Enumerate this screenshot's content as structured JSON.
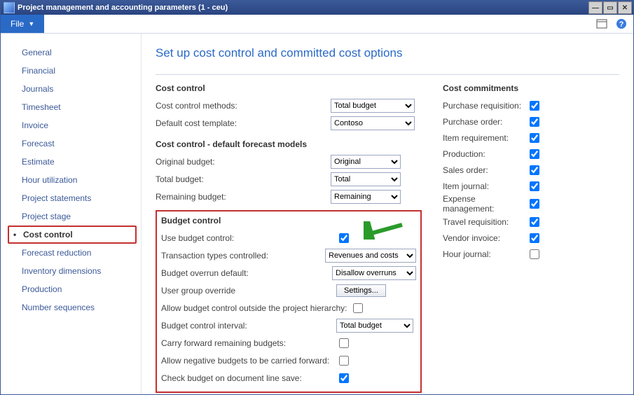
{
  "window": {
    "title": "Project management and accounting parameters (1 - ceu)"
  },
  "menubar": {
    "file": "File"
  },
  "sidebar": {
    "items": [
      "General",
      "Financial",
      "Journals",
      "Timesheet",
      "Invoice",
      "Forecast",
      "Estimate",
      "Hour utilization",
      "Project statements",
      "Project stage",
      "Cost control",
      "Forecast reduction",
      "Inventory dimensions",
      "Production",
      "Number sequences"
    ],
    "selected": 10
  },
  "page": {
    "title": "Set up cost control and committed cost options"
  },
  "cost_control": {
    "heading": "Cost control",
    "methods_label": "Cost control methods:",
    "methods_value": "Total budget",
    "template_label": "Default cost template:",
    "template_value": "Contoso"
  },
  "forecast": {
    "heading": "Cost control - default forecast models",
    "original_label": "Original budget:",
    "original_value": "Original",
    "total_label": "Total budget:",
    "total_value": "Total",
    "remaining_label": "Remaining budget:",
    "remaining_value": "Remaining"
  },
  "budget": {
    "heading": "Budget control",
    "use_label": "Use budget control:",
    "use_checked": true,
    "types_label": "Transaction types controlled:",
    "types_value": "Revenues and costs",
    "overrun_label": "Budget overrun default:",
    "overrun_value": "Disallow overruns",
    "override_label": "User group override",
    "settings_btn": "Settings...",
    "outside_label": "Allow budget control outside the project hierarchy:",
    "interval_label": "Budget control interval:",
    "interval_value": "Total budget",
    "carry_label": "Carry forward remaining budgets:",
    "neg_label": "Allow negative budgets to be carried forward:",
    "check_label": "Check budget on document line save:",
    "check_checked": true
  },
  "commit": {
    "heading": "Cost commitments",
    "rows": [
      {
        "label": "Purchase requisition:",
        "checked": true
      },
      {
        "label": "Purchase order:",
        "checked": true
      },
      {
        "label": "Item requirement:",
        "checked": true
      },
      {
        "label": "Production:",
        "checked": true
      },
      {
        "label": "Sales order:",
        "checked": true
      },
      {
        "label": "Item journal:",
        "checked": true
      },
      {
        "label": "Expense management:",
        "checked": true
      },
      {
        "label": "Travel requisition:",
        "checked": true
      },
      {
        "label": "Vendor invoice:",
        "checked": true
      },
      {
        "label": "Hour journal:",
        "checked": false
      }
    ]
  }
}
